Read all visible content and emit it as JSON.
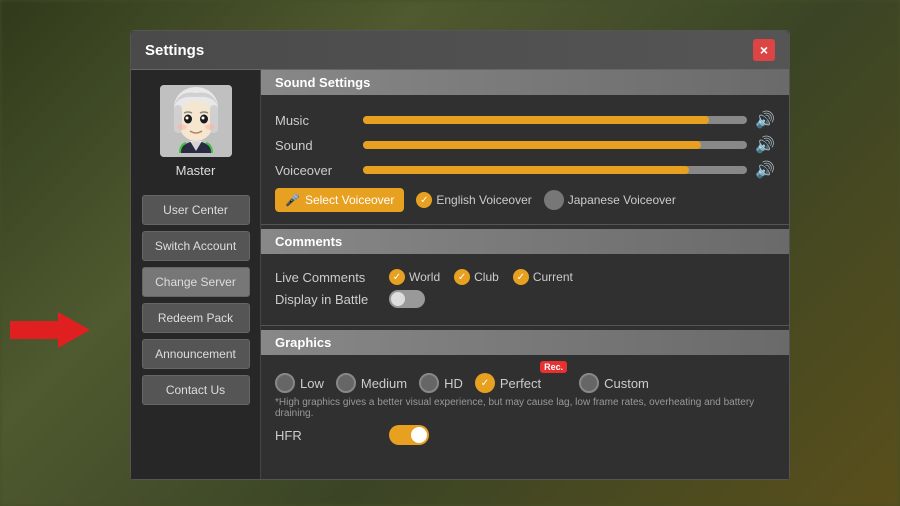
{
  "background": {
    "color": "#5a6a3a"
  },
  "dialog": {
    "title": "Settings",
    "close_label": "×"
  },
  "sidebar": {
    "username": "Master",
    "buttons": [
      {
        "label": "User Center",
        "id": "user-center"
      },
      {
        "label": "Switch Account",
        "id": "switch-account"
      },
      {
        "label": "Change Server",
        "id": "change-server",
        "active": true
      },
      {
        "label": "Redeem Pack",
        "id": "redeem-pack"
      },
      {
        "label": "Announcement",
        "id": "announcement"
      },
      {
        "label": "Contact Us",
        "id": "contact-us"
      }
    ]
  },
  "sound_settings": {
    "header": "Sound Settings",
    "music": {
      "label": "Music",
      "fill_percent": 90
    },
    "sound": {
      "label": "Sound",
      "fill_percent": 88
    },
    "voiceover": {
      "label": "Voiceover",
      "fill_percent": 85
    },
    "select_voiceover_label": "Select Voiceover",
    "english_voiceover_label": "English Voiceover",
    "japanese_voiceover_label": "Japanese Voiceover"
  },
  "comments": {
    "header": "Comments",
    "live_comments_label": "Live Comments",
    "world_label": "World",
    "club_label": "Club",
    "current_label": "Current",
    "display_in_battle_label": "Display in Battle"
  },
  "graphics": {
    "header": "Graphics",
    "options": [
      {
        "label": "Low",
        "selected": false
      },
      {
        "label": "Medium",
        "selected": false
      },
      {
        "label": "HD",
        "selected": false
      },
      {
        "label": "Perfect",
        "selected": true,
        "rec": true
      },
      {
        "label": "Custom",
        "selected": false
      }
    ],
    "note": "*High graphics gives a better visual experience, but may cause lag, low frame rates, overheating and battery draining.",
    "hfr_label": "HFR",
    "rec_badge": "Rec."
  },
  "icons": {
    "mic": "🎤",
    "volume": "🔊",
    "check": "✓"
  }
}
